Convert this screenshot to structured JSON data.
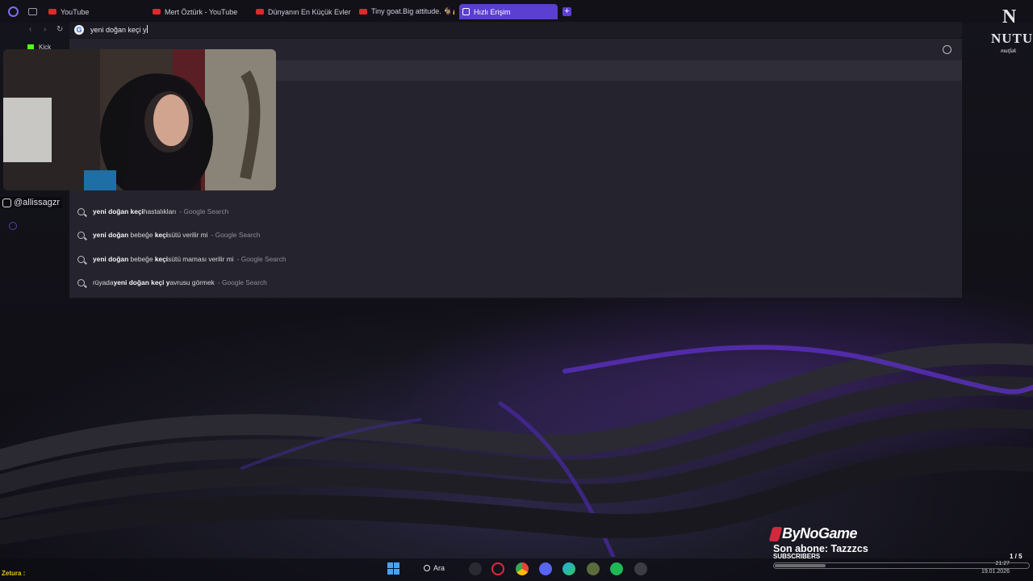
{
  "browser": {
    "tabs": [
      {
        "label": "YouTube",
        "icon": "youtube-icon",
        "active": false
      },
      {
        "label": "Mert Öztürk - YouTube",
        "icon": "youtube-icon",
        "active": false
      },
      {
        "label": "Dünyanın En Küçük Evleri",
        "icon": "youtube-icon",
        "active": false
      },
      {
        "label": "Tiny goat.Big attitude. 🐐💪",
        "icon": "youtube-icon",
        "active": false
      },
      {
        "label": "Hızlı Erişim",
        "icon": "speed-dial-icon",
        "active": true
      }
    ],
    "address_value": "yeni doğan keçi y",
    "bookmarks": [
      {
        "label": "Kick"
      }
    ]
  },
  "suggestions": [
    {
      "pre": "",
      "bold1": "yeni doğan",
      "mid": " ",
      "bold2": "keçi",
      "post": " hastalıkları",
      "source": "- Google Search"
    },
    {
      "pre": "",
      "bold1": "yeni doğan",
      "mid": " bebeğe ",
      "bold2": "keçi",
      "post": " sütü verilir mi",
      "source": "- Google Search"
    },
    {
      "pre": "",
      "bold1": "yeni doğan",
      "mid": " bebeğe ",
      "bold2": "keçi",
      "post": " sütü maması verilir mi",
      "source": "- Google Search"
    },
    {
      "pre": "rüyada ",
      "bold1": "yeni doğan",
      "mid": " ",
      "bold2": "keçi y",
      "post": "avrusu görmek",
      "source": "- Google Search"
    }
  ],
  "stream": {
    "handle": "@allissagzr",
    "brand": "ByNoGame",
    "last_sub_label": "Son abone: Tazzzcs",
    "subs_label": "SUBSCRIBERS",
    "subs_count": "1 / 5",
    "subs_progress": 0.2,
    "chat_user": "Zetura :"
  },
  "logo": {
    "letter": "N",
    "word": "NUTU",
    "tag": "mutfak"
  },
  "taskbar": {
    "search_label": "Ara",
    "time": "21:27",
    "date": "19.01.2026"
  },
  "colors": {
    "accent": "#5a3fd0",
    "youtube": "#e5262c",
    "kick": "#53fc18",
    "bynogame": "#d6283c"
  }
}
